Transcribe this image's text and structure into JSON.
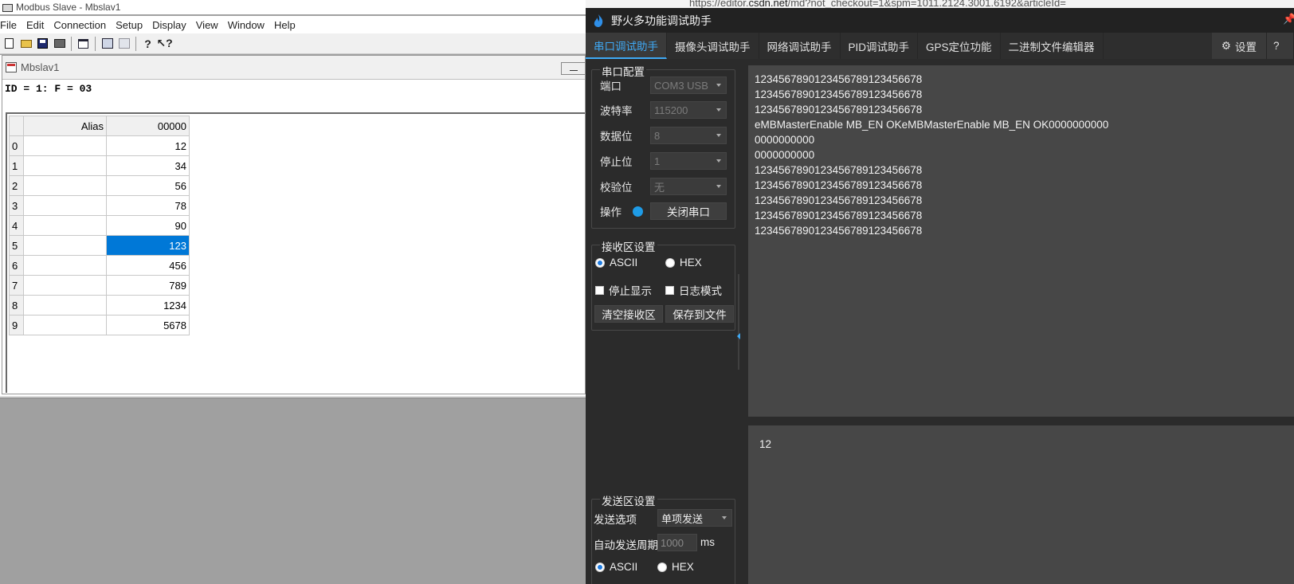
{
  "modbus": {
    "window_title": "Modbus Slave - Mbslav1",
    "menu": [
      "File",
      "Edit",
      "Connection",
      "Setup",
      "Display",
      "View",
      "Window",
      "Help"
    ],
    "child_title": "Mbslav1",
    "id_line": "ID = 1: F = 03",
    "columns": {
      "alias": "Alias",
      "address": "00000"
    },
    "rows": [
      {
        "index": "0",
        "alias": "",
        "value": "12"
      },
      {
        "index": "1",
        "alias": "",
        "value": "34"
      },
      {
        "index": "2",
        "alias": "",
        "value": "56"
      },
      {
        "index": "3",
        "alias": "",
        "value": "78"
      },
      {
        "index": "4",
        "alias": "",
        "value": "90"
      },
      {
        "index": "5",
        "alias": "",
        "value": "123",
        "selected": true
      },
      {
        "index": "6",
        "alias": "",
        "value": "456"
      },
      {
        "index": "7",
        "alias": "",
        "value": "789"
      },
      {
        "index": "8",
        "alias": "",
        "value": "1234"
      },
      {
        "index": "9",
        "alias": "",
        "value": "5678"
      }
    ]
  },
  "browser": {
    "url_prefix": "https://editor.",
    "url_domain": "csdn.net",
    "url_rest": "/md?not_checkout=1&spm=1011.2124.3001.6192&articleId="
  },
  "firebrand": {
    "title": "野火多功能调试助手",
    "tabs": [
      "串口调试助手",
      "摄像头调试助手",
      "网络调试助手",
      "PID调试助手",
      "GPS定位功能",
      "二进制文件编辑器"
    ],
    "active_tab": 0,
    "settings_label": "设置",
    "serial_config": {
      "group_title": "串口配置",
      "port_label": "端口",
      "port_value": "COM3 USB",
      "baud_label": "波特率",
      "baud_value": "115200",
      "databits_label": "数据位",
      "databits_value": "8",
      "stopbits_label": "停止位",
      "stopbits_value": "1",
      "parity_label": "校验位",
      "parity_value": "无",
      "operation_label": "操作",
      "close_port_label": "关闭串口"
    },
    "receive_settings": {
      "group_title": "接收区设置",
      "ascii_label": "ASCII",
      "hex_label": "HEX",
      "mode": "ASCII",
      "stop_display_label": "停止显示",
      "log_mode_label": "日志模式",
      "clear_label": "清空接收区",
      "save_label": "保存到文件"
    },
    "send_settings": {
      "group_title": "发送区设置",
      "send_option_label": "发送选项",
      "send_option_value": "单项发送",
      "auto_period_label": "自动发送周期",
      "auto_period_value": "1000",
      "unit": "ms",
      "ascii_label": "ASCII",
      "hex_label": "HEX",
      "mode": "ASCII"
    },
    "received_lines": [
      "1234567890123456789123456678",
      "1234567890123456789123456678",
      "1234567890123456789123456678",
      "eMBMasterEnable MB_EN OKeMBMasterEnable MB_EN OK0000000000",
      "0000000000",
      "0000000000",
      "1234567890123456789123456678",
      "1234567890123456789123456678",
      "1234567890123456789123456678",
      "1234567890123456789123456678",
      "1234567890123456789123456678"
    ],
    "send_text": "12",
    "accent_color": "#3fa9f5"
  }
}
